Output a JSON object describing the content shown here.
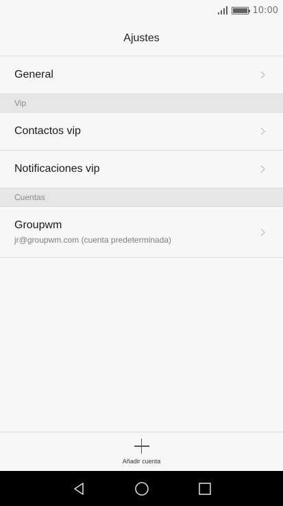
{
  "status_bar": {
    "time": "10:00",
    "icons": [
      "signal-icon",
      "battery-icon"
    ]
  },
  "header": {
    "title": "Ajustes"
  },
  "rows": {
    "general": {
      "label": "General"
    },
    "vip_section": {
      "label": "Vip"
    },
    "contactos_vip": {
      "label": "Contactos vip"
    },
    "notificaciones_vip": {
      "label": "Notificaciones vip"
    },
    "cuentas_section": {
      "label": "Cuentas"
    },
    "account": {
      "name": "Groupwm",
      "email": "jr@groupwm.com (cuenta predeterminada)"
    }
  },
  "bottom_action": {
    "icon": "plus-icon",
    "label": "Añadir cuenta"
  },
  "nav": {
    "icons": [
      "back-icon",
      "home-icon",
      "recents-icon"
    ]
  },
  "colors": {
    "background": "#f7f7f7",
    "section": "#e6e6e6",
    "nav_bar": "#000000"
  }
}
